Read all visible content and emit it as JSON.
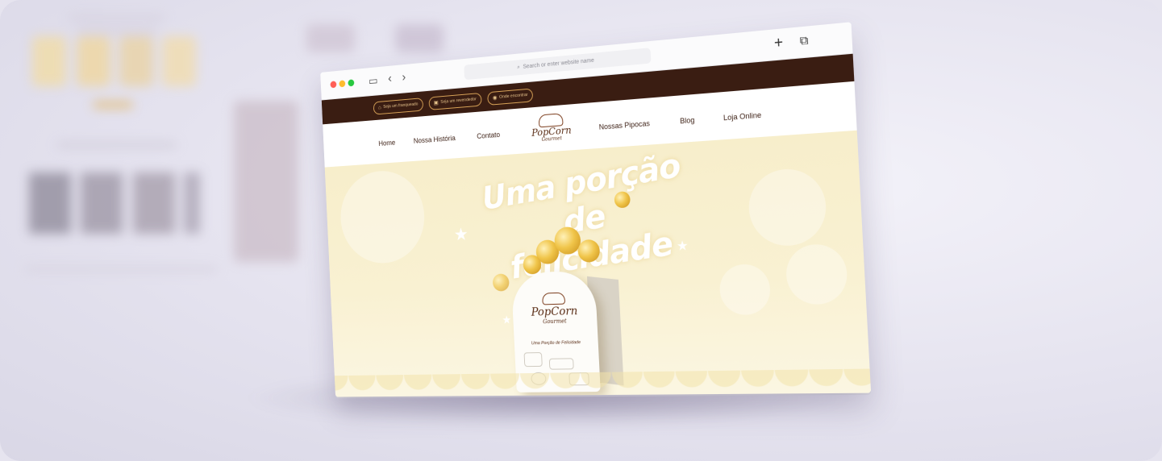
{
  "browser": {
    "address_placeholder": "Search or enter website name",
    "icons": [
      "sidebar-icon",
      "back-icon",
      "forward-icon",
      "search-icon",
      "new-tab-icon",
      "tabs-overview-icon"
    ]
  },
  "topbar": {
    "pills": [
      {
        "label": "Seja um franqueado",
        "icon": "store-icon"
      },
      {
        "label": "Seja um revendedor",
        "icon": "bag-icon"
      },
      {
        "label": "Onde encontrar",
        "icon": "location-icon"
      }
    ]
  },
  "nav": {
    "items": [
      "Home",
      "Nossa História",
      "Contato",
      "Nossas Pipocas",
      "Blog",
      "Loja Online"
    ],
    "logo": {
      "brand": "PopCorn",
      "sub": "Gourmet"
    }
  },
  "hero": {
    "headline_line1": "Uma porção de",
    "headline_line2": "felicidade",
    "box": {
      "brand": "PopCorn",
      "sub": "Gourmet",
      "tagline": "Uma Porção de Felicidade"
    }
  },
  "colors": {
    "topbar": "#3a1d12",
    "accent_gold": "#d9a458",
    "hero_bg": "#f7eecb",
    "text_brown": "#3a1d12"
  }
}
